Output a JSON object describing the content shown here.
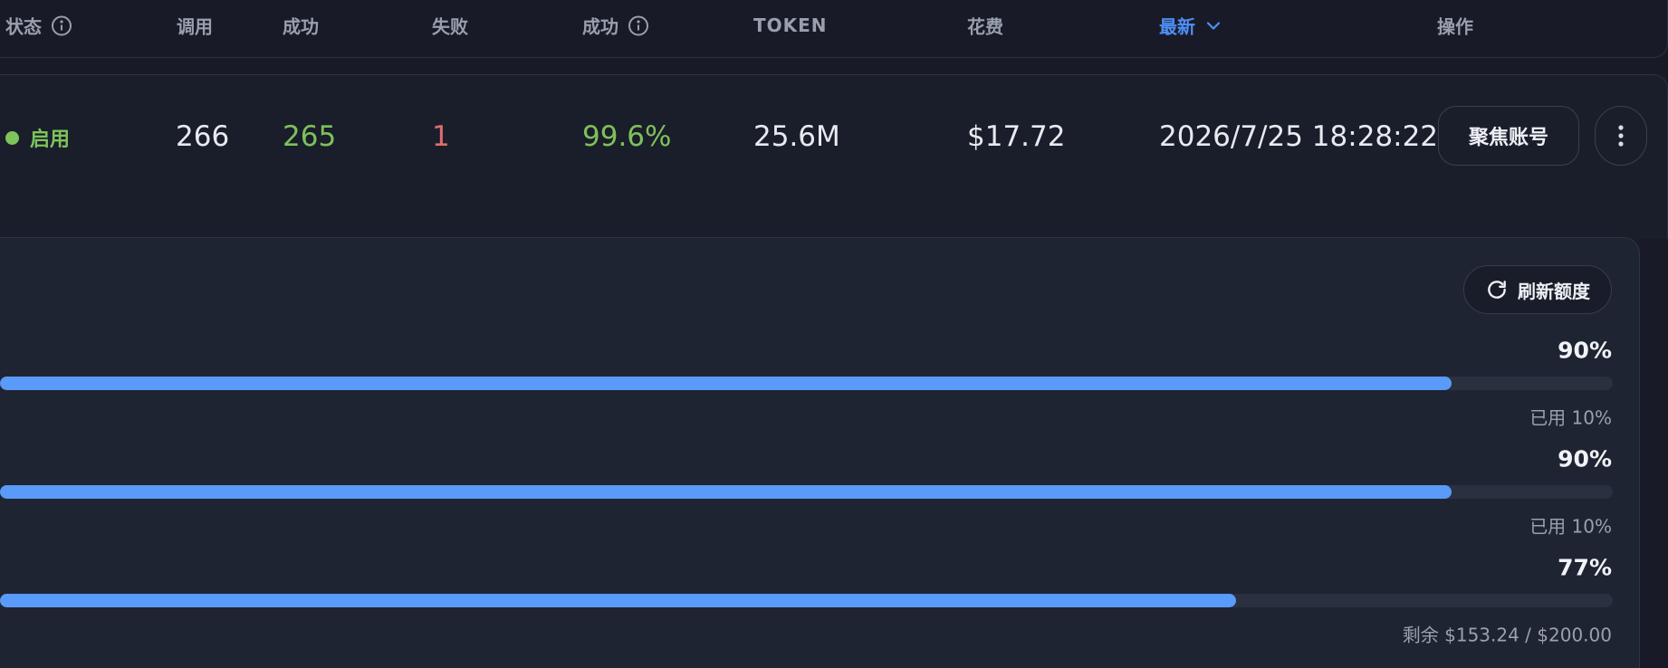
{
  "header": {
    "status": "状态",
    "calls": "调用",
    "success": "成功",
    "fail": "失败",
    "success_rate": "成功",
    "token": "TOKEN",
    "cost": "花费",
    "latest": "最新",
    "actions": "操作"
  },
  "row": {
    "status": "启用",
    "calls": "266",
    "success": "265",
    "fail": "1",
    "success_rate": "99.6%",
    "token": "25.6M",
    "cost": "$17.72",
    "latest": "2026/7/25 18:28:22",
    "focus_button": "聚焦账号"
  },
  "quota": {
    "refresh_button": "刷新额度",
    "bars": [
      {
        "percent_label": "90%",
        "remaining_fraction": 0.9,
        "caption": "已用 10%"
      },
      {
        "percent_label": "90%",
        "remaining_fraction": 0.9,
        "caption": "已用 10%"
      },
      {
        "percent_label": "77%",
        "remaining_fraction": 0.7662,
        "caption": "剩余 $153.24 / $200.00"
      }
    ]
  },
  "colors": {
    "accent": "#4f8ff7",
    "bar_fill": "#5a9af8",
    "success": "#7fc05a",
    "error": "#e06c6c"
  },
  "icons": {
    "info": "info-icon",
    "sort": "chevron-down-icon",
    "more": "more-vertical-icon",
    "refresh": "refresh-icon"
  }
}
